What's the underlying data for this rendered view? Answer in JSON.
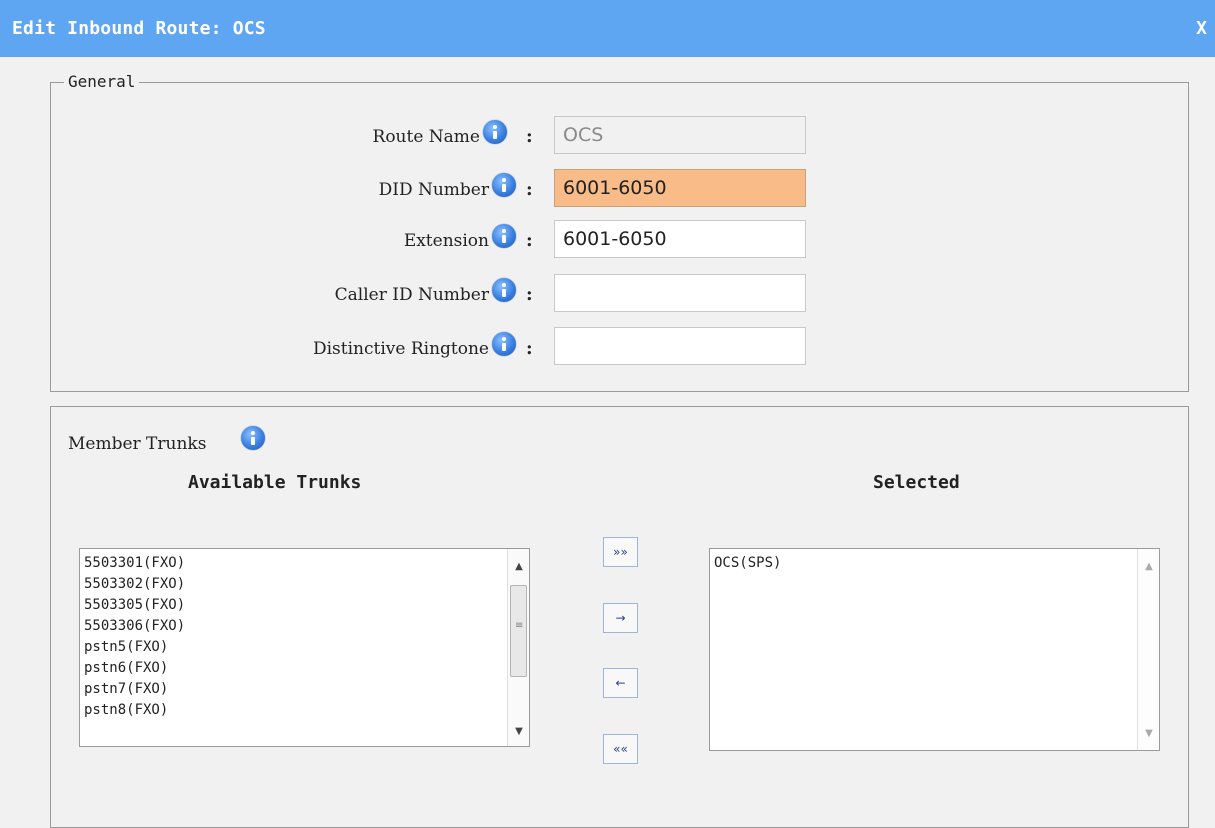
{
  "dialog": {
    "title": "Edit Inbound Route: OCS",
    "close_label": "X"
  },
  "general": {
    "legend": "General",
    "fields": [
      {
        "label": "Route Name",
        "colon": ":",
        "value": "OCS"
      },
      {
        "label": "DID Number",
        "colon": ":",
        "value": "6001-6050"
      },
      {
        "label": "Extension",
        "colon": ":",
        "value": "6001-6050"
      },
      {
        "label": "Caller ID Number",
        "colon": ":",
        "value": ""
      },
      {
        "label": "Distinctive Ringtone",
        "colon": ":",
        "value": ""
      }
    ]
  },
  "trunks": {
    "label": "Member Trunks",
    "available_heading": "Available Trunks",
    "selected_heading": "Selected",
    "available": [
      "5503301(FXO)",
      "5503302(FXO)",
      "5503305(FXO)",
      "5503306(FXO)",
      "pstn5(FXO)",
      "pstn6(FXO)",
      "pstn7(FXO)",
      "pstn8(FXO)"
    ],
    "selected": [
      "OCS(SPS)"
    ],
    "buttons": {
      "add_all": "»»",
      "add": "→",
      "remove": "←",
      "remove_all": "««"
    }
  },
  "colors": {
    "titlebar": "#5ea6f2",
    "highlight_field": "#f9bc88",
    "background": "#f1f1f1"
  }
}
